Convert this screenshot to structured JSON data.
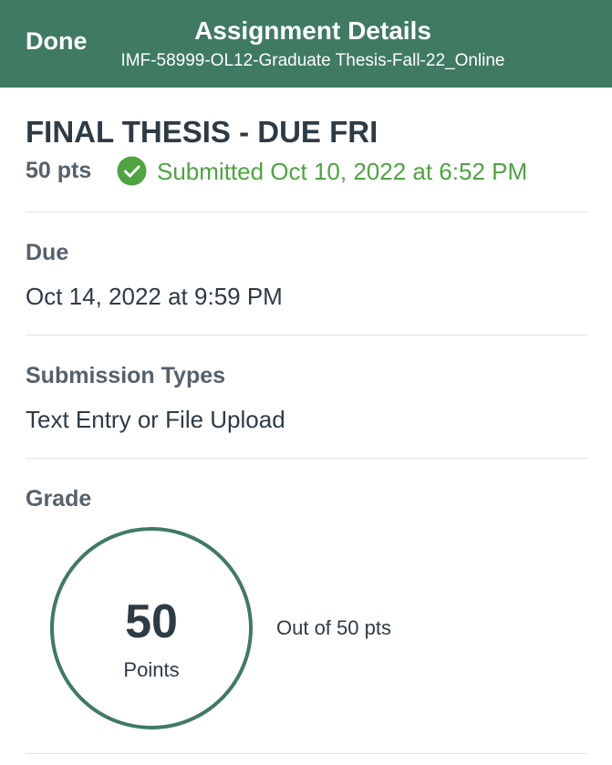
{
  "header": {
    "done_label": "Done",
    "title": "Assignment Details",
    "subtitle": "IMF-58999-OL12-Graduate Thesis-Fall-22_Online",
    "background_color": "#3f7a63"
  },
  "assignment": {
    "name": "FINAL THESIS - DUE FRI",
    "points": "50 pts",
    "status_icon": "checkmark-circle-icon",
    "status_text": "Submitted Oct 10, 2022 at 6:52 PM",
    "status_color": "#4fa341"
  },
  "due": {
    "label": "Due",
    "value": "Oct 14, 2022 at 9:59 PM"
  },
  "submission_types": {
    "label": "Submission Types",
    "value": "Text Entry or File Upload"
  },
  "grade": {
    "label": "Grade",
    "score": "50",
    "unit": "Points",
    "out_of": "Out of 50 pts",
    "fraction": 1.0,
    "ring_color": "#3f7a63"
  }
}
